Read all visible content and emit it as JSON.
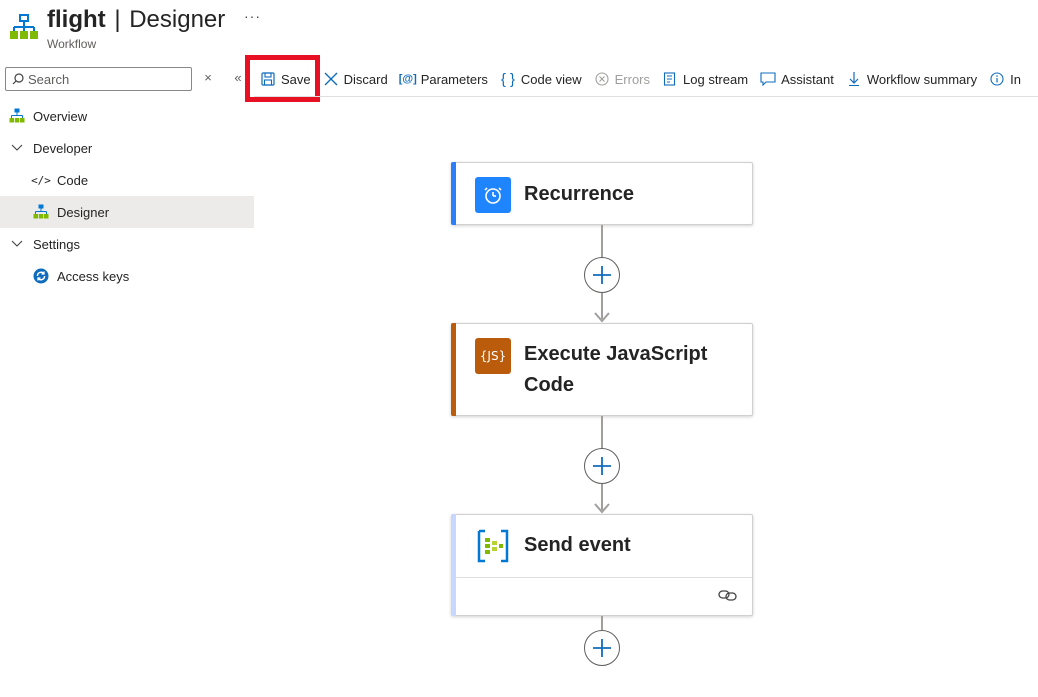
{
  "header": {
    "app_name": "flight",
    "separator": "|",
    "page_name": "Designer",
    "subtitle": "Workflow",
    "more_label": "···"
  },
  "search": {
    "placeholder": "Search",
    "clear_label": "×",
    "collapse_label": "«"
  },
  "toolbar": {
    "save": "Save",
    "discard": "Discard",
    "parameters": "Parameters",
    "code_view": "Code view",
    "errors": "Errors",
    "log_stream": "Log stream",
    "assistant": "Assistant",
    "workflow_summary": "Workflow summary",
    "info": "In"
  },
  "nav": {
    "overview": "Overview",
    "developer": "Developer",
    "code": "Code",
    "designer": "Designer",
    "settings": "Settings",
    "access_keys": "Access keys"
  },
  "workflow": {
    "steps": [
      {
        "title": "Recurrence",
        "accent": "#2d7ff9",
        "icon": "clock-icon",
        "icon_bg": "#1f85ff"
      },
      {
        "title_line1": "Execute JavaScript",
        "title_line2": "Code",
        "accent": "#ba5c0b",
        "icon": "javascript-icon",
        "icon_bg": "#ba5c0b",
        "icon_text": "{JS}"
      },
      {
        "title": "Send event",
        "accent": "#c7d7ff",
        "icon": "event-hub-icon",
        "icon_bg": "#ffffff"
      }
    ]
  },
  "colors": {
    "highlight": "#e81123",
    "accent_blue": "#0f6cbd"
  }
}
